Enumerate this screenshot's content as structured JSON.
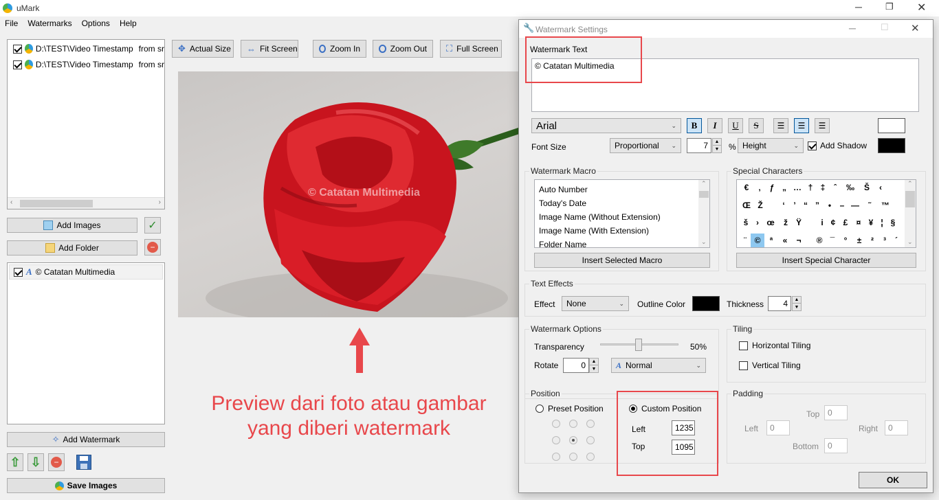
{
  "app": {
    "title": "uMark"
  },
  "menu": [
    "File",
    "Watermarks",
    "Options",
    "Help"
  ],
  "files": [
    {
      "path": "D:\\TEST\\Video Timestamp",
      "suffix": "from sr"
    },
    {
      "path": "D:\\TEST\\Video Timestamp",
      "suffix": "from sr"
    }
  ],
  "left": {
    "add_images": "Add Images",
    "add_folder": "Add Folder",
    "watermark_item": "© Catatan Multimedia",
    "add_watermark": "Add Watermark",
    "save_images": "Save Images"
  },
  "toolbar": {
    "actual_size": "Actual Size",
    "fit_screen": "Fit Screen",
    "zoom_in": "Zoom In",
    "zoom_out": "Zoom Out",
    "full_screen": "Full Screen"
  },
  "preview": {
    "watermark_text": "© Catatan Multimedia",
    "annotation_line1": "Preview dari foto atau gambar",
    "annotation_line2": "yang diberi watermark"
  },
  "dialog": {
    "title": "Watermark Settings",
    "watermark_text_label": "Watermark Text",
    "watermark_text_value": "© Catatan Multimedia",
    "font": "Arial",
    "fmt_bold": "B",
    "fmt_italic": "I",
    "fmt_underline": "U",
    "fmt_strike": "S",
    "font_size_label": "Font Size",
    "font_size_mode": "Proportional",
    "font_size_value": "7",
    "percent": "%",
    "relative_to": "Height",
    "add_shadow": "Add Shadow",
    "macro": {
      "title": "Watermark Macro",
      "items": [
        "Auto Number",
        "Today's Date",
        "Image Name (Without Extension)",
        "Image Name (With Extension)",
        "Folder Name"
      ],
      "insert": "Insert Selected Macro"
    },
    "special": {
      "title": "Special Characters",
      "rows": [
        [
          "€",
          "‚",
          "ƒ",
          "„",
          "…",
          "†",
          "‡",
          "ˆ",
          "‰",
          "Š",
          "‹"
        ],
        [
          "Œ",
          "Ž",
          "",
          "‘",
          "’",
          "“",
          "”",
          "•",
          "–",
          "—",
          "˜",
          "™"
        ],
        [
          "š",
          "›",
          "œ",
          "ž",
          "Ÿ",
          "",
          "i",
          "¢",
          "£",
          "¤",
          "¥",
          "¦",
          "§"
        ],
        [
          "¨",
          "©",
          "ª",
          "«",
          "¬",
          "",
          "®",
          "¯",
          "°",
          "±",
          "²",
          "³",
          "´"
        ]
      ],
      "insert": "Insert Special Character"
    },
    "effects": {
      "title": "Text Effects",
      "effect_label": "Effect",
      "effect_value": "None",
      "outline_label": "Outline Color",
      "thickness_label": "Thickness",
      "thickness_value": "4"
    },
    "options": {
      "title": "Watermark Options",
      "transparency_label": "Transparency",
      "transparency_value": "50%",
      "transparency_fraction": 0.5,
      "rotate_label": "Rotate",
      "rotate_value": "0",
      "blend_mode": "Normal"
    },
    "tiling": {
      "title": "Tiling",
      "horizontal": "Horizontal Tiling",
      "vertical": "Vertical Tiling"
    },
    "position": {
      "title": "Position",
      "preset": "Preset Position",
      "custom": "Custom Position",
      "left_label": "Left",
      "left_value": "1235",
      "top_label": "Top",
      "top_value": "1095"
    },
    "padding": {
      "title": "Padding",
      "top_label": "Top",
      "top_value": "0",
      "left_label": "Left",
      "left_value": "0",
      "right_label": "Right",
      "right_value": "0",
      "bottom_label": "Bottom",
      "bottom_value": "0"
    },
    "ok": "OK"
  },
  "colors": {
    "accent_red": "#e8474b",
    "rose": "#d8202a",
    "selection": "#cce4f7"
  }
}
